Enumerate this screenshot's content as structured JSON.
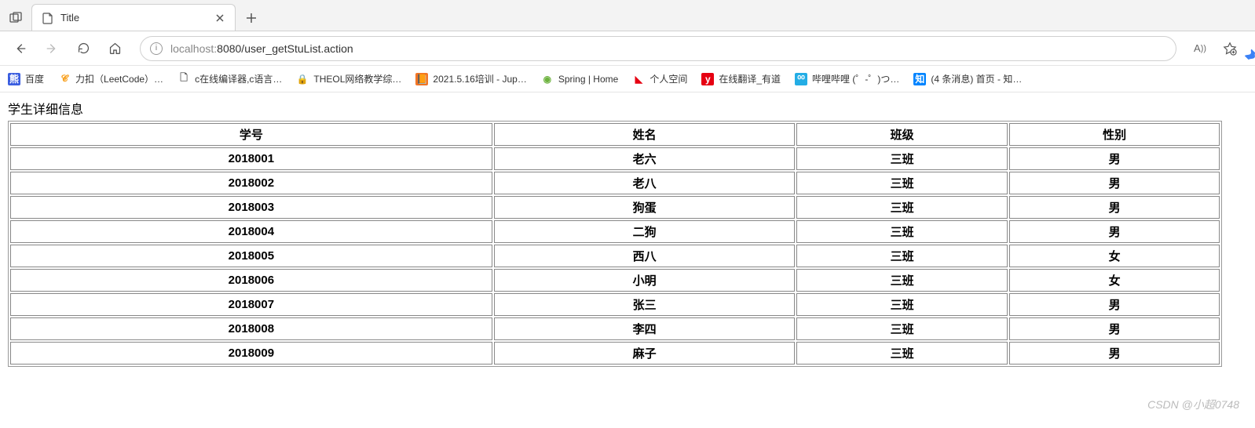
{
  "browser": {
    "tab_title": "Title",
    "url_muted": "localhost:",
    "url_rest": "8080/user_getStuList.action",
    "read_aloud": "A⁾⁾"
  },
  "bookmarks": [
    {
      "icon_bg": "#3b5ee0",
      "icon_color": "#fff",
      "glyph": "熊",
      "label": "百度"
    },
    {
      "icon_bg": "#fff",
      "icon_color": "#f89f1b",
      "glyph": "𝓒",
      "label": "力扣（LeetCode）…"
    },
    {
      "icon_bg": "#fff",
      "icon_color": "#555",
      "glyph": "🗋",
      "label": "c在线编译器,c语言…"
    },
    {
      "icon_bg": "#fff",
      "icon_color": "#2aa7d9",
      "glyph": "🔒",
      "label": "THEOL网络教学综…"
    },
    {
      "icon_bg": "#f37626",
      "icon_color": "#fff",
      "glyph": "📙",
      "label": "2021.5.16培训 - Jup…"
    },
    {
      "icon_bg": "#fff",
      "icon_color": "#6db33f",
      "glyph": "◉",
      "label": "Spring | Home"
    },
    {
      "icon_bg": "#fff",
      "icon_color": "#e60012",
      "glyph": "◣",
      "label": "个人空间"
    },
    {
      "icon_bg": "#e60012",
      "icon_color": "#fff",
      "glyph": "y",
      "label": "在线翻译_有道"
    },
    {
      "icon_bg": "#23ade5",
      "icon_color": "#fff",
      "glyph": "⁰⁰",
      "label": "哔哩哔哩 (゜-゜)つ…"
    },
    {
      "icon_bg": "#0084ff",
      "icon_color": "#fff",
      "glyph": "知",
      "label": "(4 条消息) 首页 - 知…"
    }
  ],
  "page": {
    "heading": "学生详细信息",
    "columns": [
      "学号",
      "姓名",
      "班级",
      "性别"
    ],
    "rows": [
      [
        "2018001",
        "老六",
        "三班",
        "男"
      ],
      [
        "2018002",
        "老八",
        "三班",
        "男"
      ],
      [
        "2018003",
        "狗蛋",
        "三班",
        "男"
      ],
      [
        "2018004",
        "二狗",
        "三班",
        "男"
      ],
      [
        "2018005",
        "西八",
        "三班",
        "女"
      ],
      [
        "2018006",
        "小明",
        "三班",
        "女"
      ],
      [
        "2018007",
        "张三",
        "三班",
        "男"
      ],
      [
        "2018008",
        "李四",
        "三班",
        "男"
      ],
      [
        "2018009",
        "麻子",
        "三班",
        "男"
      ]
    ]
  },
  "watermark": "CSDN @小超0748"
}
